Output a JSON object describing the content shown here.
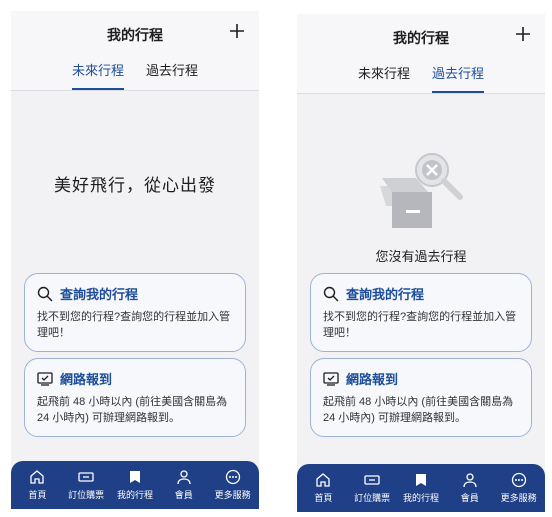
{
  "left": {
    "title": "我的行程",
    "tabs": [
      {
        "label": "未來行程",
        "active": true
      },
      {
        "label": "過去行程",
        "active": false
      }
    ],
    "hero": "美好飛行，從心出發",
    "cards": [
      {
        "title": "查詢我的行程",
        "desc": "找不到您的行程?查詢您的行程並加入管理吧！",
        "icon": "search-icon"
      },
      {
        "title": "網路報到",
        "desc": "起飛前 48 小時以內 (前往美國含關島為 24 小時內) 可辦理網路報到。",
        "icon": "monitor-check-icon"
      }
    ]
  },
  "right": {
    "title": "我的行程",
    "tabs": [
      {
        "label": "未來行程",
        "active": false
      },
      {
        "label": "過去行程",
        "active": true
      }
    ],
    "empty_text": "您沒有過去行程",
    "cards": [
      {
        "title": "查詢我的行程",
        "desc": "找不到您的行程?查詢您的行程並加入管理吧！",
        "icon": "search-icon"
      },
      {
        "title": "網路報到",
        "desc": "起飛前 48 小時以內 (前往美國含關島為 24 小時內) 可辦理網路報到。",
        "icon": "monitor-check-icon"
      }
    ]
  },
  "nav": [
    {
      "label": "首頁",
      "icon": "home-icon"
    },
    {
      "label": "訂位購票",
      "icon": "ticket-icon"
    },
    {
      "label": "我的行程",
      "icon": "bookmark-icon"
    },
    {
      "label": "會員",
      "icon": "user-icon"
    },
    {
      "label": "更多服務",
      "icon": "more-icon"
    }
  ],
  "colors": {
    "brand": "#1d4e9a",
    "nav_bg": "#1f3f86"
  }
}
